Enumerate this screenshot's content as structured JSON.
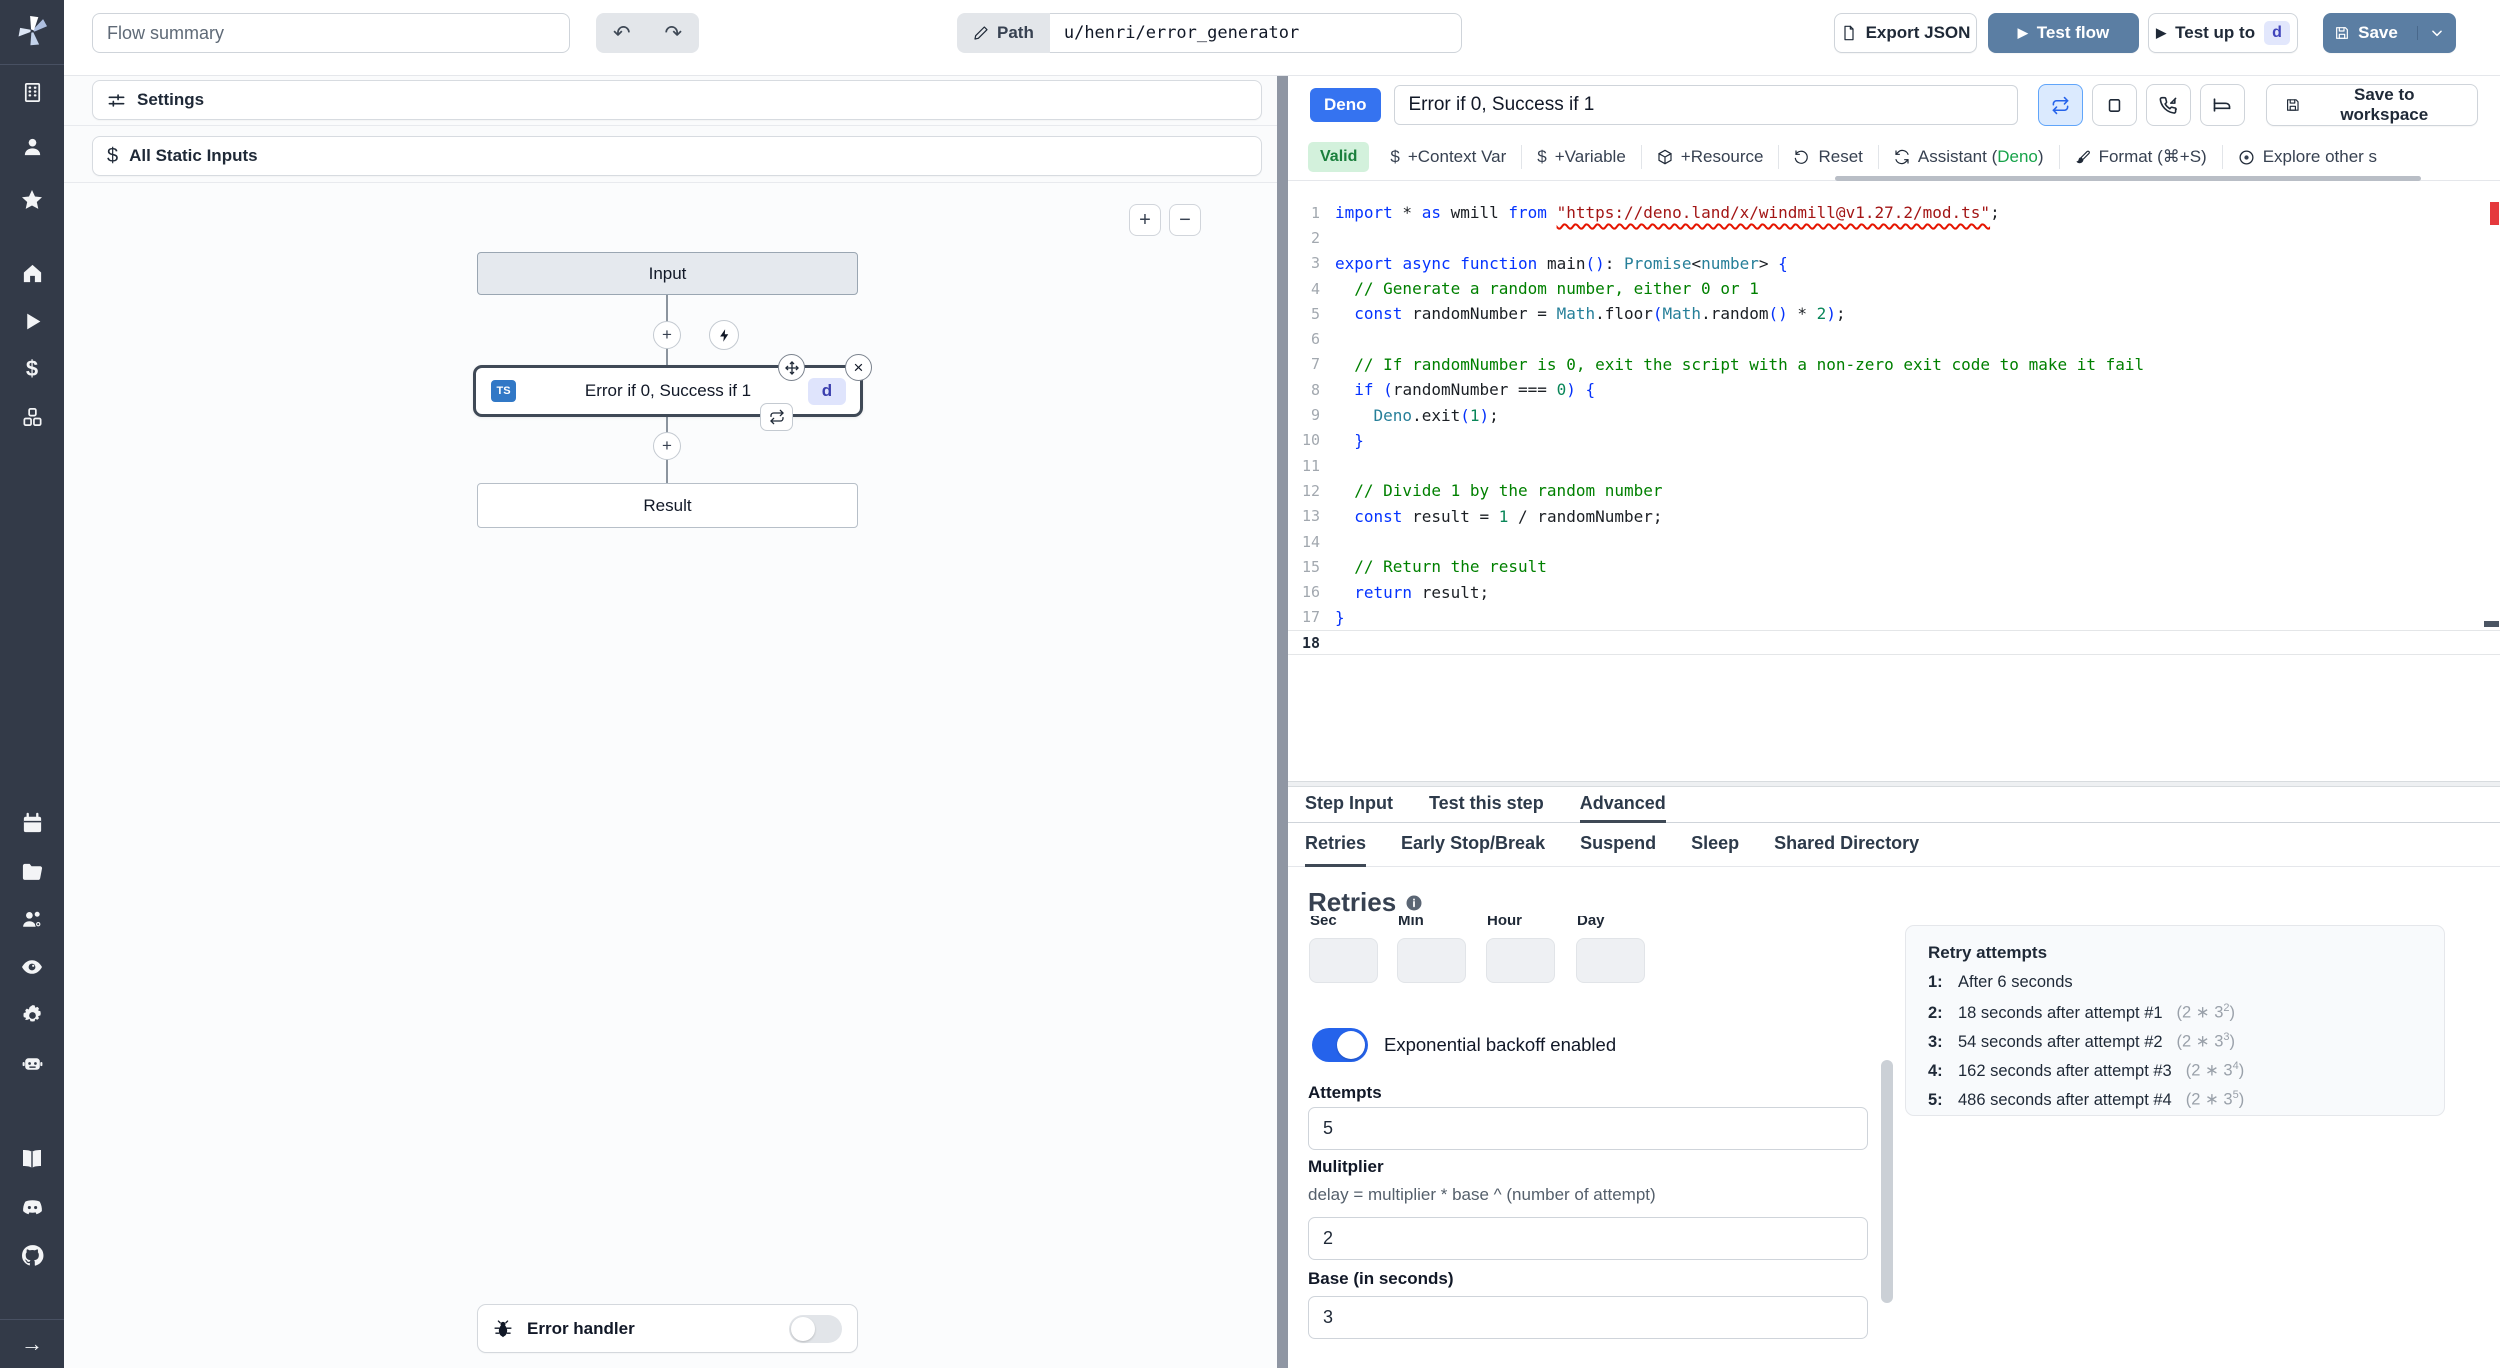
{
  "topbar": {
    "flow_summary_placeholder": "Flow summary",
    "path_label": "Path",
    "path_value": "u/henri/error_generator",
    "export_json": "Export JSON",
    "test_flow": "Test flow",
    "test_up_to": "Test up to",
    "test_up_to_badge": "d",
    "save": "Save"
  },
  "icons": {
    "undo": "↶",
    "redo": "↷",
    "play": "▶",
    "plus": "+",
    "minus": "−",
    "close": "×",
    "arrow_right": "→",
    "dollar": "$",
    "gear": "⚙"
  },
  "flow_panel": {
    "settings": "Settings",
    "all_static_inputs": "All Static Inputs",
    "input_node": "Input",
    "step_title": "Error if 0, Success if 1",
    "step_lang_badge": "TS",
    "step_id_badge": "d",
    "result_node": "Result",
    "error_handler": "Error handler"
  },
  "editor_header": {
    "lang_badge": "Deno",
    "step_name": "Error if 0, Success if 1",
    "save_to_workspace": "Save to workspace"
  },
  "editor_toolbar": {
    "valid": "Valid",
    "context_var": "+Context Var",
    "variable": "+Variable",
    "resource": "+Resource",
    "reset": "Reset",
    "assistant_prefix": "Assistant (",
    "assistant_lang": "Deno",
    "assistant_suffix": ")",
    "format": "Format (⌘+S)",
    "explore": "Explore other s"
  },
  "code": {
    "lines": [
      {
        "n": 1,
        "tokens": [
          [
            "k",
            "import"
          ],
          [
            "d",
            " * "
          ],
          [
            "k",
            "as"
          ],
          [
            "d",
            " wmill "
          ],
          [
            "k",
            "from"
          ],
          [
            "d",
            " "
          ],
          [
            "se",
            "\"https://deno.land/x/windmill@v1.27.2/mod.ts\""
          ],
          [
            "d",
            ";"
          ]
        ]
      },
      {
        "n": 2,
        "tokens": []
      },
      {
        "n": 3,
        "tokens": [
          [
            "k",
            "export"
          ],
          [
            "d",
            " "
          ],
          [
            "k",
            "async"
          ],
          [
            "d",
            " "
          ],
          [
            "k",
            "function"
          ],
          [
            "d",
            " main"
          ],
          [
            "b",
            "()"
          ],
          [
            "d",
            ": "
          ],
          [
            "t",
            "Promise"
          ],
          [
            "d",
            "<"
          ],
          [
            "t",
            "number"
          ],
          [
            "d",
            "> "
          ],
          [
            "b",
            "{"
          ]
        ]
      },
      {
        "n": 4,
        "tokens": [
          [
            "c",
            "  // Generate a random number, either 0 or 1"
          ]
        ]
      },
      {
        "n": 5,
        "tokens": [
          [
            "k",
            "  const"
          ],
          [
            "d",
            " randomNumber = "
          ],
          [
            "t",
            "Math"
          ],
          [
            "d",
            ".floor"
          ],
          [
            "b",
            "("
          ],
          [
            "t",
            "Math"
          ],
          [
            "d",
            ".random"
          ],
          [
            "b",
            "()"
          ],
          [
            "d",
            " * "
          ],
          [
            "n",
            "2"
          ],
          [
            "b",
            ")"
          ],
          [
            "d",
            ";"
          ]
        ]
      },
      {
        "n": 6,
        "tokens": []
      },
      {
        "n": 7,
        "tokens": [
          [
            "c",
            "  // If randomNumber is 0, exit the script with a non-zero exit code to make it fail"
          ]
        ]
      },
      {
        "n": 8,
        "tokens": [
          [
            "k",
            "  if"
          ],
          [
            "d",
            " "
          ],
          [
            "b",
            "("
          ],
          [
            "d",
            "randomNumber === "
          ],
          [
            "n",
            "0"
          ],
          [
            "b",
            ")"
          ],
          [
            "d",
            " "
          ],
          [
            "b",
            "{"
          ]
        ]
      },
      {
        "n": 9,
        "tokens": [
          [
            "d",
            "    "
          ],
          [
            "t",
            "Deno"
          ],
          [
            "d",
            ".exit"
          ],
          [
            "b",
            "("
          ],
          [
            "n",
            "1"
          ],
          [
            "b",
            ")"
          ],
          [
            "d",
            ";"
          ]
        ]
      },
      {
        "n": 10,
        "tokens": [
          [
            "d",
            "  "
          ],
          [
            "b",
            "}"
          ]
        ]
      },
      {
        "n": 11,
        "tokens": []
      },
      {
        "n": 12,
        "tokens": [
          [
            "c",
            "  // Divide 1 by the random number"
          ]
        ]
      },
      {
        "n": 13,
        "tokens": [
          [
            "k",
            "  const"
          ],
          [
            "d",
            " result = "
          ],
          [
            "n",
            "1"
          ],
          [
            "d",
            " / randomNumber;"
          ]
        ]
      },
      {
        "n": 14,
        "tokens": []
      },
      {
        "n": 15,
        "tokens": [
          [
            "c",
            "  // Return the result"
          ]
        ]
      },
      {
        "n": 16,
        "tokens": [
          [
            "k",
            "  return"
          ],
          [
            "d",
            " result;"
          ]
        ]
      },
      {
        "n": 17,
        "tokens": [
          [
            "b",
            "}"
          ]
        ]
      },
      {
        "n": 18,
        "active": true,
        "tokens": []
      }
    ]
  },
  "bottom_tabs": {
    "0": "Step Input",
    "1": "Test this step",
    "2": "Advanced"
  },
  "advanced_tabs": {
    "0": "Retries",
    "1": "Early Stop/Break",
    "2": "Suspend",
    "3": "Sleep",
    "4": "Shared Directory"
  },
  "retries": {
    "heading": "Retries",
    "time_labels": {
      "0": "Sec",
      "1": "Min",
      "2": "Hour",
      "3": "Day"
    },
    "toggle_label": "Exponential backoff enabled",
    "attempts_label": "Attempts",
    "attempts_value": "5",
    "multiplier_label": "Mulitplier",
    "multiplier_help": "delay = multiplier * base ^ (number of attempt)",
    "multiplier_value": "2",
    "base_label": "Base (in seconds)",
    "base_value": "3",
    "panel_title": "Retry attempts",
    "attempts": [
      {
        "num": "1:",
        "text": "After 6 seconds",
        "base": "",
        "exp": "",
        "close": ""
      },
      {
        "num": "2:",
        "text": "18 seconds after attempt #1",
        "base": "(2 ∗ 3",
        "exp": "2",
        "close": ")"
      },
      {
        "num": "3:",
        "text": "54 seconds after attempt #2",
        "base": "(2 ∗ 3",
        "exp": "3",
        "close": ")"
      },
      {
        "num": "4:",
        "text": "162 seconds after attempt #3",
        "base": "(2 ∗ 3",
        "exp": "4",
        "close": ")"
      },
      {
        "num": "5:",
        "text": "486 seconds after attempt #4",
        "base": "(2 ∗ 3",
        "exp": "5",
        "close": ")"
      }
    ]
  }
}
